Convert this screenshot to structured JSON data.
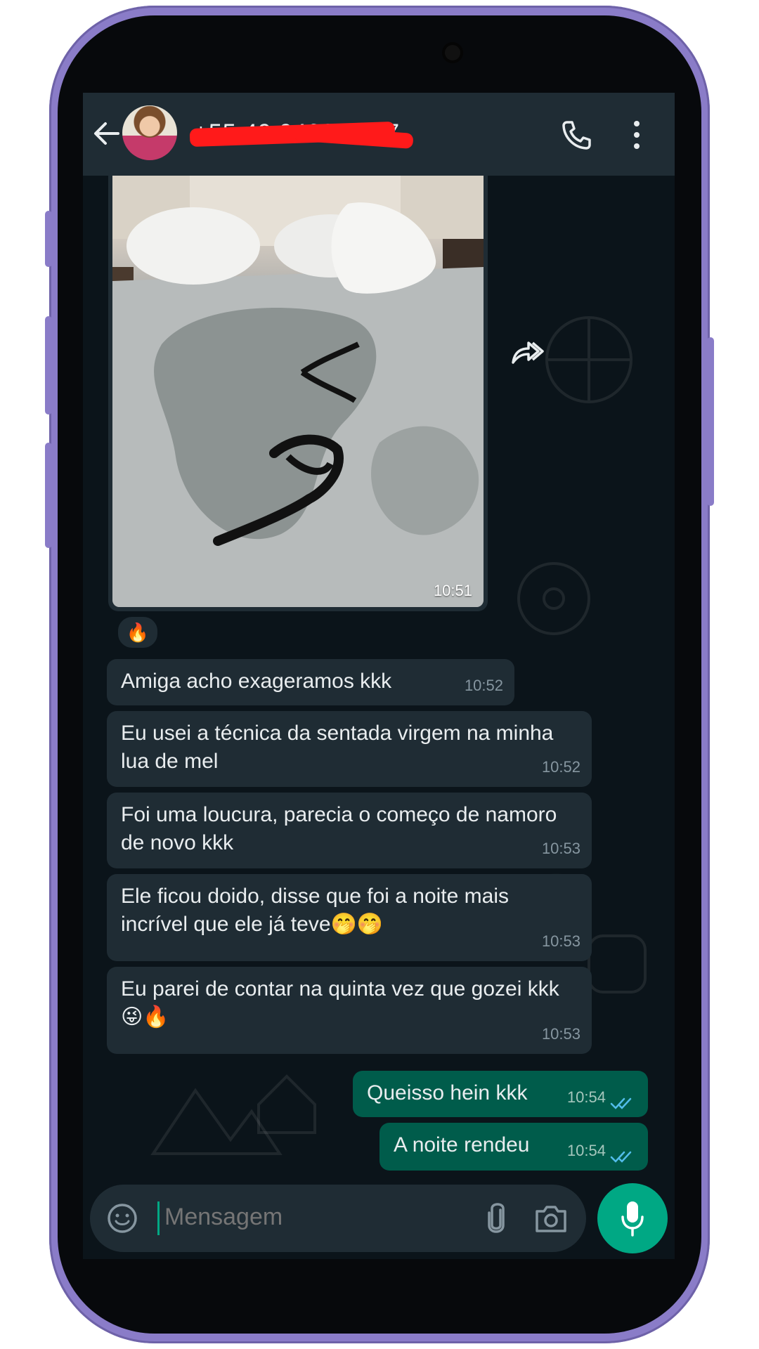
{
  "header": {
    "contact_name": "+55 49 9403-5047",
    "back_icon": "arrow-left-icon",
    "call_icon": "phone-icon",
    "menu_icon": "more-vertical-icon"
  },
  "media_message": {
    "time": "10:51",
    "reaction": "🔥"
  },
  "messages": [
    {
      "text": "Amiga acho exageramos kkk",
      "time": "10:52"
    },
    {
      "text": "Eu usei a técnica da sentada virgem na minha lua de mel",
      "time": "10:52"
    },
    {
      "text": "Foi uma loucura, parecia o começo de namoro de novo kkk",
      "time": "10:53"
    },
    {
      "text": "Ele ficou doido, disse que foi a noite mais incrível que ele já teve🤭🤭",
      "time": "10:53"
    },
    {
      "text": "Eu parei de contar na quinta vez que gozei kkk😜🔥",
      "time": "10:53"
    }
  ],
  "sent": [
    {
      "text": "Queisso hein kkk",
      "time": "10:54"
    },
    {
      "text": "A noite rendeu",
      "time": "10:54"
    }
  ],
  "composer": {
    "placeholder": "Mensagem"
  },
  "colors": {
    "header": "#1f2c34",
    "incoming": "#1f2c34",
    "outgoing": "#005c4b",
    "accent": "#00a884",
    "background": "#0b141a",
    "frame": "#8a7cc8"
  }
}
